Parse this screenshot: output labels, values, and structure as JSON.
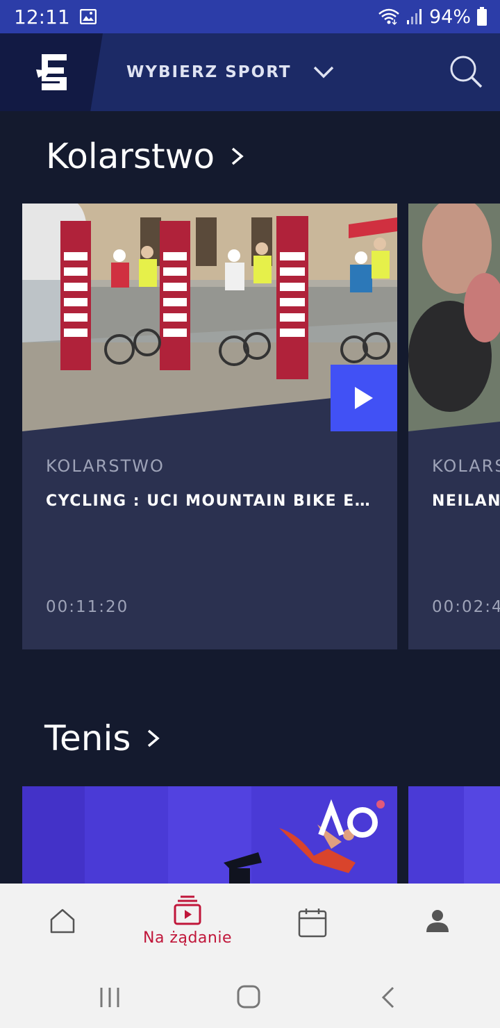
{
  "status_bar": {
    "time": "12:11",
    "battery": "94%",
    "bg_color": "#2c3da8"
  },
  "header": {
    "sport_picker_label": "WYBIERZ SPORT",
    "icons": [
      "eurosport-logo-icon",
      "chevron-down-icon",
      "search-icon"
    ]
  },
  "sections": [
    {
      "title": "Kolarstwo",
      "cards": [
        {
          "sport": "KOLARSTWO",
          "title": "CYCLING : UCI MOUNTAIN BIKE E…",
          "duration": "00:11:20"
        },
        {
          "sport": "KOLARSTWO",
          "title": "NEILANDS",
          "duration": "00:02:4"
        }
      ]
    },
    {
      "title": "Tenis"
    }
  ],
  "bottom_nav": {
    "items": [
      {
        "icon": "home-icon",
        "label": ""
      },
      {
        "icon": "on-demand-icon",
        "label": "Na żądanie",
        "active": true
      },
      {
        "icon": "calendar-icon",
        "label": ""
      },
      {
        "icon": "profile-icon",
        "label": ""
      }
    ],
    "active_color": "#c0163a"
  },
  "system_nav": [
    "recents-icon",
    "home-circle-icon",
    "back-icon"
  ],
  "colors": {
    "background": "#141a2e",
    "header": "#1c2a66",
    "card": "#2b3150",
    "play_button": "#4151f5"
  }
}
